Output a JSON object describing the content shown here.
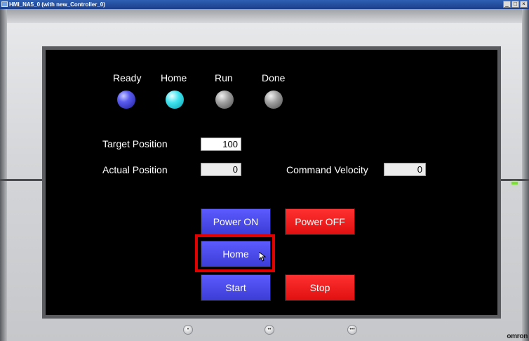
{
  "window": {
    "title": "HMI_NA5_0 (with new_Controller_0)",
    "buttons": [
      "_",
      "□",
      "×"
    ]
  },
  "lamps": [
    {
      "label": "Ready",
      "color": "#4b4de6"
    },
    {
      "label": "Home",
      "color": "#3fe3ee"
    },
    {
      "label": "Run",
      "color": "#8a8a8a"
    },
    {
      "label": "Done",
      "color": "#8a8a8a"
    }
  ],
  "fields": {
    "target_position": {
      "label": "Target Position",
      "value": "100"
    },
    "actual_position": {
      "label": "Actual Position",
      "value": "0"
    },
    "command_velocity": {
      "label": "Command Velocity",
      "value": "0"
    }
  },
  "buttons": {
    "power_on": "Power ON",
    "power_off": "Power OFF",
    "home": "Home",
    "start": "Start",
    "stop": "Stop"
  },
  "function_keys": [
    "•",
    "••",
    "•••"
  ],
  "brand": "omron",
  "colors": {
    "screen_bg": "#000000",
    "button_blue": "#4646e8",
    "button_red": "#f01e1e",
    "highlight": "#e00000"
  }
}
